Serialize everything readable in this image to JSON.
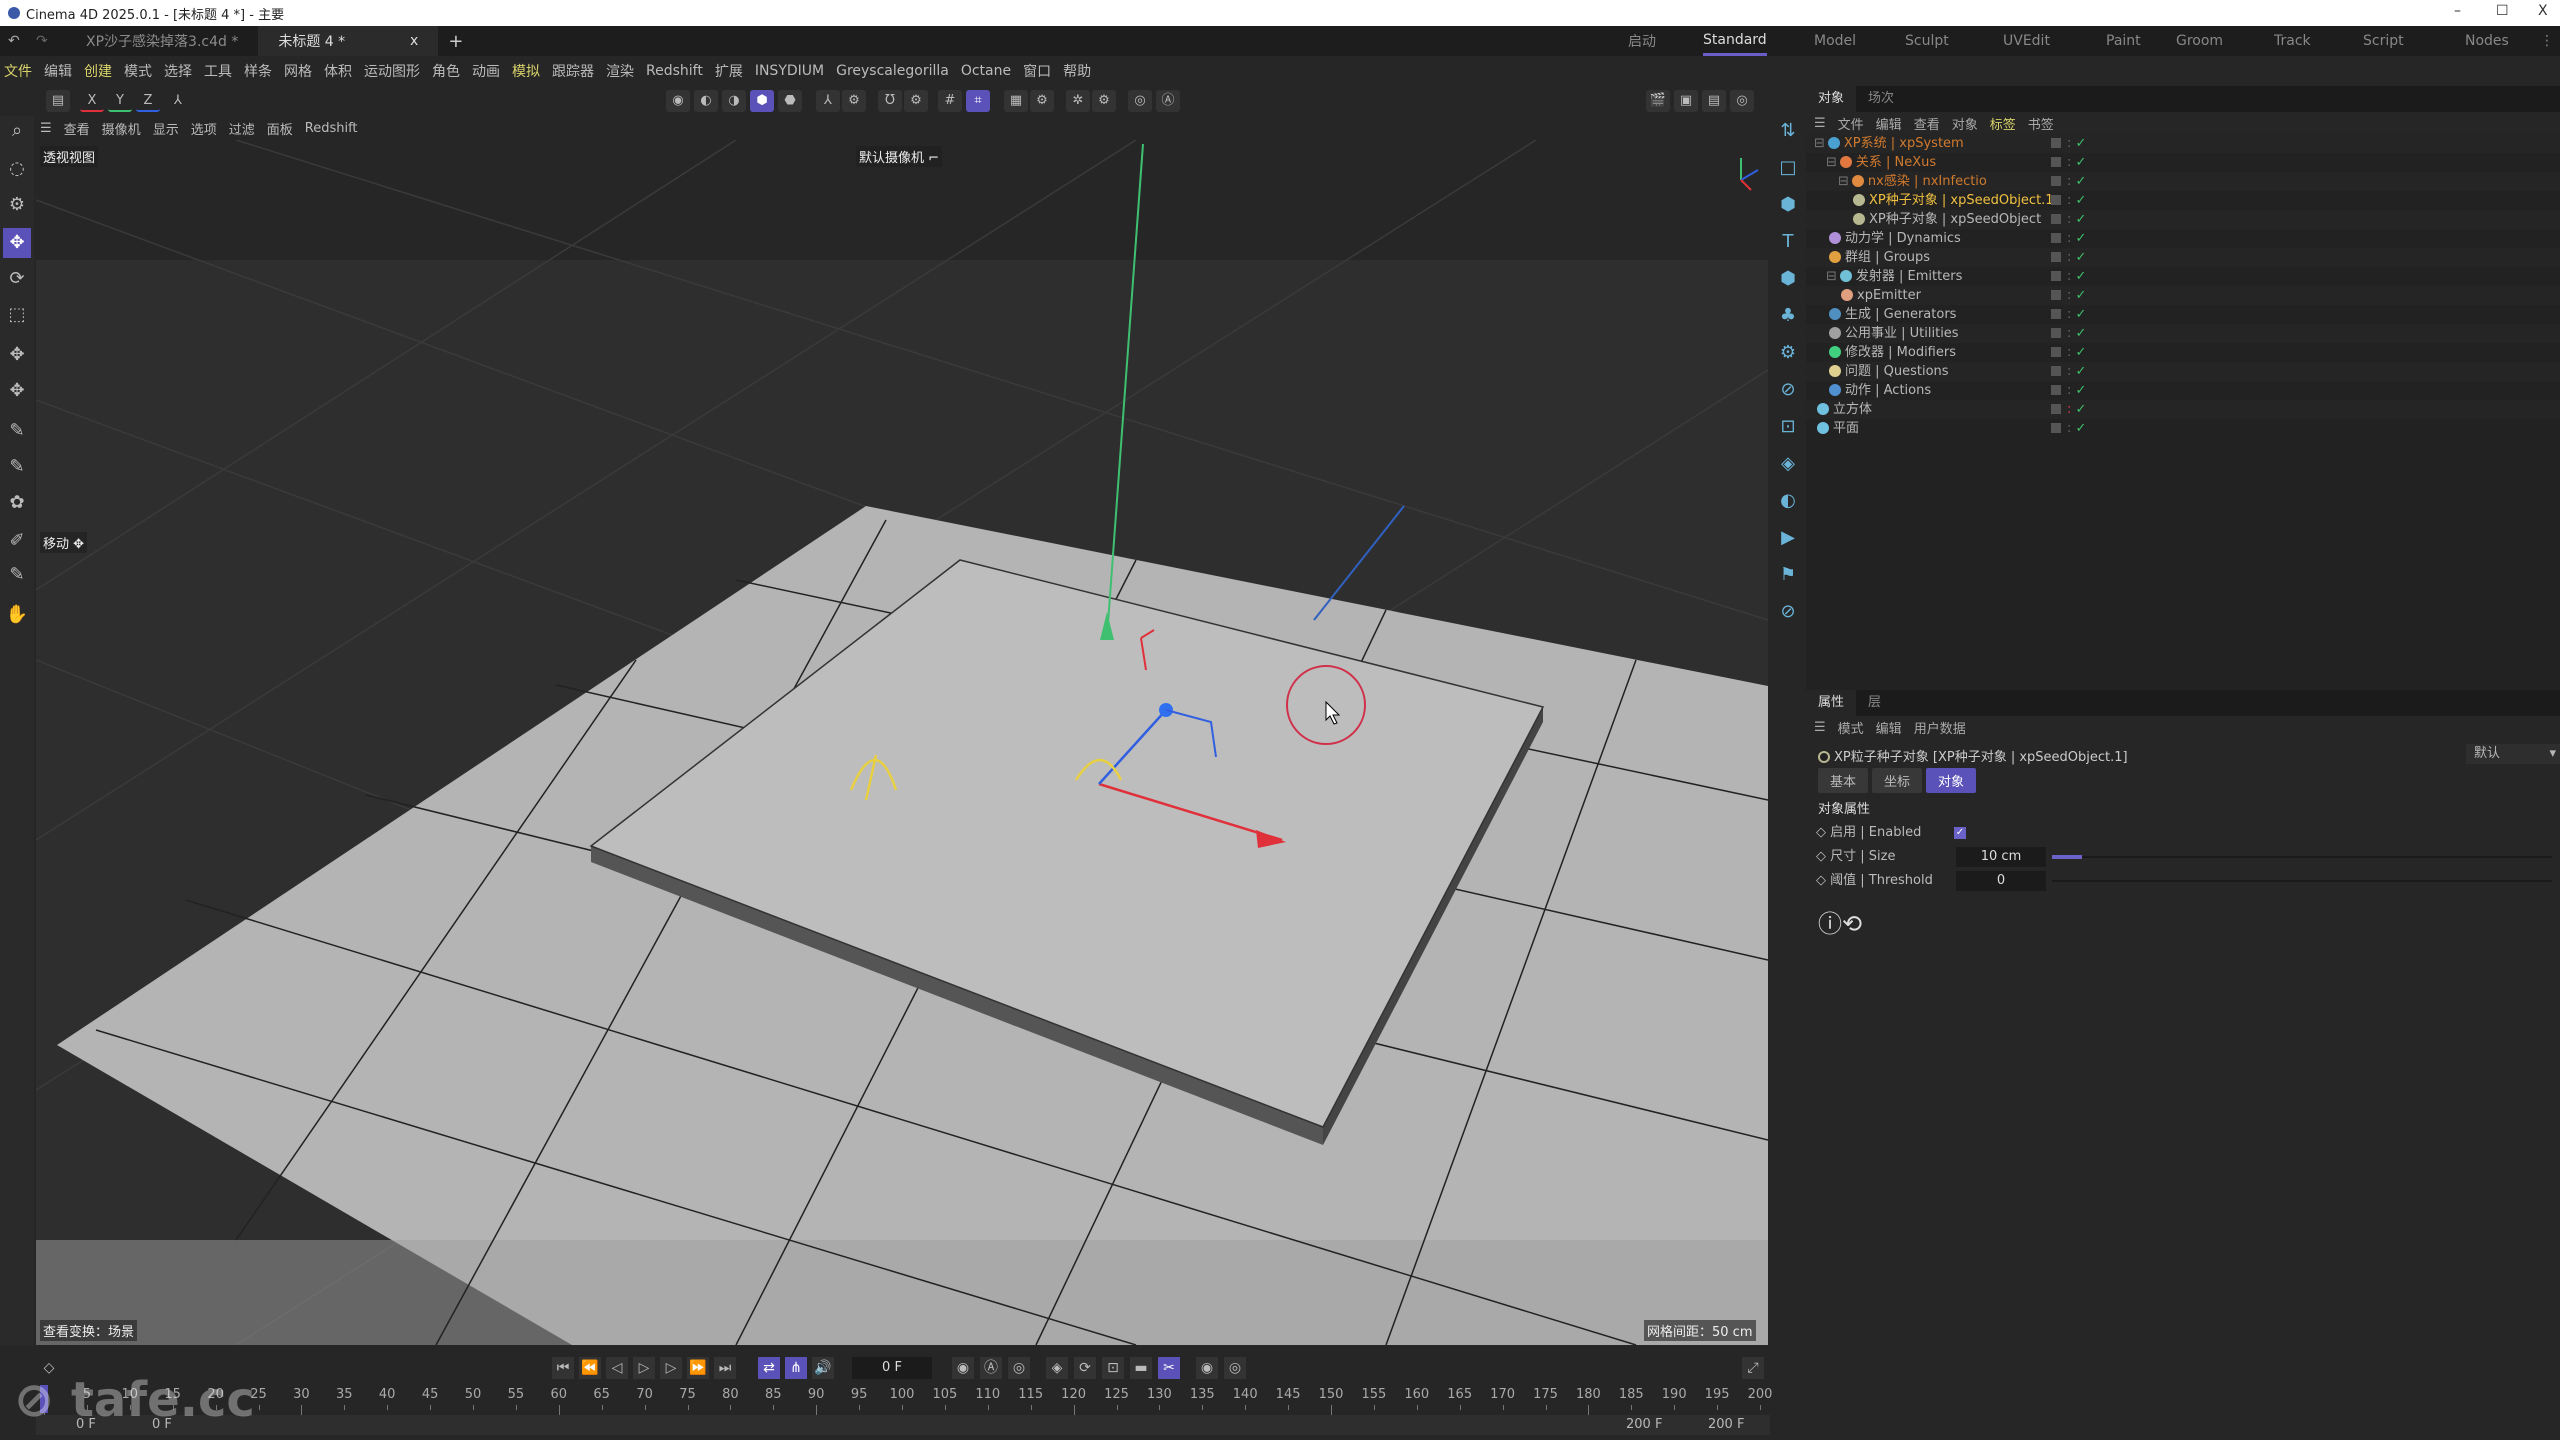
{
  "window": {
    "title": "Cinema 4D 2025.0.1 - [未标题 4 *] - 主要",
    "min": "–",
    "max": "☐",
    "close": "X"
  },
  "doc_tabs": [
    {
      "label": "XP沙子感染掉落3.c4d *"
    },
    {
      "label": "未标题 4 *",
      "close": "x"
    }
  ],
  "new_tab": "+",
  "layouts": [
    "启动",
    "Standard",
    "Model",
    "Sculpt",
    "UVEdit",
    "Paint",
    "Groom",
    "Track",
    "Script",
    "Nodes"
  ],
  "active_layout": "Standard",
  "menus": [
    "文件",
    "编辑",
    "创建",
    "模式",
    "选择",
    "工具",
    "样条",
    "网格",
    "体积",
    "运动图形",
    "角色",
    "动画",
    "模拟",
    "跟踪器",
    "渲染",
    "Redshift",
    "扩展",
    "INSYDIUM",
    "Greyscalegorilla",
    "Octane",
    "窗口",
    "帮助"
  ],
  "highlight_menus": [
    "文件",
    "创建",
    "模拟"
  ],
  "axis_lock": [
    "X",
    "Y",
    "Z"
  ],
  "viewport_menu": [
    "查看",
    "摄像机",
    "显示",
    "选项",
    "过滤",
    "面板",
    "Redshift"
  ],
  "viewport": {
    "view_name": "透视视图",
    "camera": "默认摄像机 ⌐",
    "tool": "移动 ✥",
    "transform": "查看变换：场景",
    "grid_spacing": "网格间距：50 cm"
  },
  "object_manager": {
    "tabs": [
      "对象",
      "场次"
    ],
    "menu": [
      "文件",
      "编辑",
      "查看",
      "对象",
      "标签",
      "书签"
    ],
    "tree": [
      {
        "label": "XP系统 | xpSystem",
        "depth": 0,
        "color": "#d07a2e",
        "icon": "#4aa0d0"
      },
      {
        "label": "关系 | NeXus",
        "depth": 1,
        "color": "#d07a2e",
        "icon": "#e07840"
      },
      {
        "label": "nx感染 | nxInfectio",
        "depth": 2,
        "color": "#d07a2e",
        "icon": "#e08a40"
      },
      {
        "label": "XP种子对象 | xpSeedObject.1",
        "depth": 3,
        "color": "#f0c040",
        "icon": "#b8b890"
      },
      {
        "label": "XP种子对象 | xpSeedObject",
        "depth": 3,
        "color": "#b8b8b8",
        "icon": "#b8b890"
      },
      {
        "label": "动力学 | Dynamics",
        "depth": 1,
        "color": "#b8b8b8",
        "icon": "#b090d8"
      },
      {
        "label": "群组 | Groups",
        "depth": 1,
        "color": "#b8b8b8",
        "icon": "#e0a040"
      },
      {
        "label": "发射器 | Emitters",
        "depth": 1,
        "color": "#b8b8b8",
        "icon": "#70c0d8"
      },
      {
        "label": "xpEmitter",
        "depth": 2,
        "color": "#b8b8b8",
        "icon": "#e0a080"
      },
      {
        "label": "生成 | Generators",
        "depth": 1,
        "color": "#b8b8b8",
        "icon": "#5090c0"
      },
      {
        "label": "公用事业 | Utilities",
        "depth": 1,
        "color": "#b8b8b8",
        "icon": "#a0a0a0"
      },
      {
        "label": "修改器 | Modifiers",
        "depth": 1,
        "color": "#b8b8b8",
        "icon": "#40d080"
      },
      {
        "label": "问题 | Questions",
        "depth": 1,
        "color": "#b8b8b8",
        "icon": "#e0d090"
      },
      {
        "label": "动作 | Actions",
        "depth": 1,
        "color": "#b8b8b8",
        "icon": "#5090d0"
      },
      {
        "label": "立方体",
        "depth": 0,
        "color": "#b8b8b8",
        "icon": "#70c0e0"
      },
      {
        "label": "平面",
        "depth": 0,
        "color": "#b8b8b8",
        "icon": "#70c0e0"
      }
    ]
  },
  "attributes": {
    "tabs": [
      "属性",
      "层"
    ],
    "menu": [
      "模式",
      "编辑",
      "用户数据"
    ],
    "object_title": "XP粒子种子对象 [XP种子对象 | xpSeedObject.1]",
    "preset": "默认",
    "subtabs": [
      "基本",
      "坐标",
      "对象"
    ],
    "active_subtab": "对象",
    "section": "对象属性",
    "enabled_label": "启用 | Enabled",
    "enabled": true,
    "size_label": "尺寸 | Size",
    "size_value": "10 cm",
    "size_slider_fraction": 0.06,
    "threshold_label": "阈值 | Threshold",
    "threshold_value": "0",
    "threshold_slider_fraction": 0
  },
  "timeline": {
    "current_frame": "0 F",
    "start": "0 F",
    "start2": "0 F",
    "end": "200 F",
    "end2": "200 F",
    "ruler_max": 200,
    "ruler_step": 5
  },
  "accent": "#5a52b8",
  "watermark": "tafe.cc"
}
